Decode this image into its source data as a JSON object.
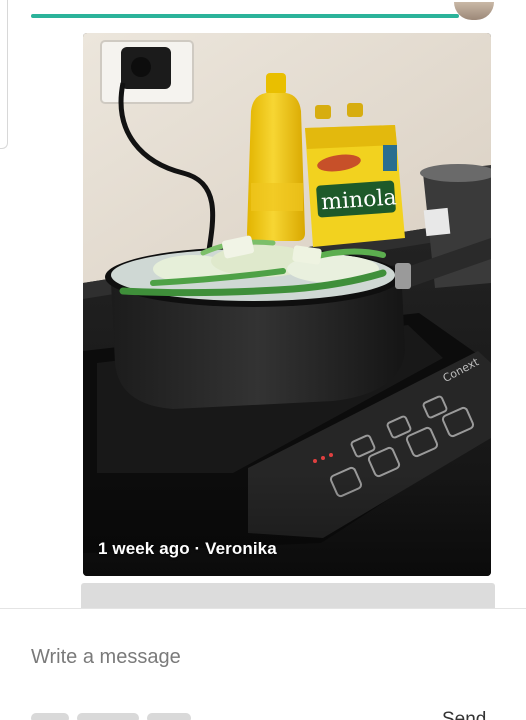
{
  "chat": {
    "photo_message": {
      "caption": "1 week ago · Veronika",
      "image_description_icon": "photo-icon"
    },
    "next_message": {
      "status": "loading"
    }
  },
  "composer": {
    "placeholder": "Write a message",
    "value": "",
    "send_label": "Send"
  },
  "colors": {
    "accent": "#2bb39a",
    "caption_text": "#ffffff",
    "placeholder_text": "#7a7a7a",
    "placeholder_bubble": "#dcdcdc"
  }
}
